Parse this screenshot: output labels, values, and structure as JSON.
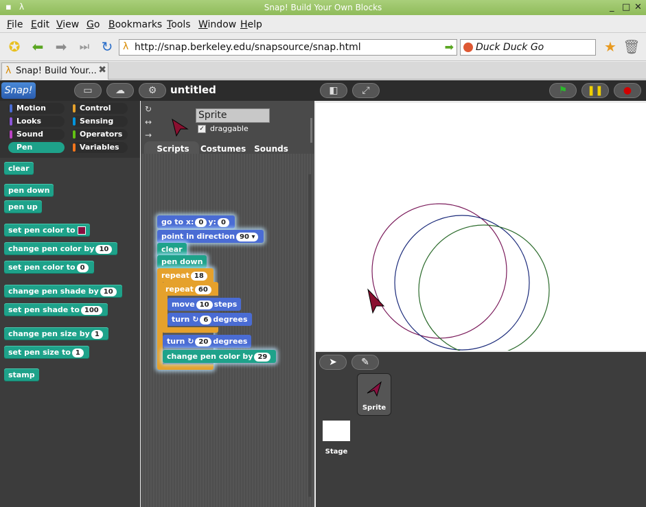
{
  "window": {
    "title": "Snap! Build Your Own Blocks"
  },
  "menu": {
    "items": [
      "File",
      "Edit",
      "View",
      "Go",
      "Bookmarks",
      "Tools",
      "Window",
      "Help"
    ]
  },
  "nav": {
    "url": "http://snap.berkeley.edu/snapsource/snap.html",
    "search_engine": "Duck Duck Go"
  },
  "tabs": [
    {
      "label": "Snap! Build Your..."
    }
  ],
  "snap": {
    "logo": "Snap!",
    "project_name": "untitled",
    "categories": [
      "Motion",
      "Control",
      "Looks",
      "Sensing",
      "Sound",
      "Operators",
      "Pen",
      "Variables"
    ],
    "category_colors": {
      "Motion": "#4a6cd4",
      "Control": "#e5a12c",
      "Looks": "#8a55d7",
      "Sensing": "#0494dc",
      "Sound": "#bb42c3",
      "Operators": "#62c213",
      "Pen": "#1ea28a",
      "Variables": "#f3761d"
    },
    "selected_category": "Pen",
    "palette": [
      {
        "text": "clear"
      },
      {
        "text": "pen down"
      },
      {
        "text": "pen up"
      },
      {
        "text": "set pen color to",
        "color": "#871040"
      },
      {
        "text": "change pen color by",
        "slot": "10"
      },
      {
        "text": "set pen color to",
        "slot": "0"
      },
      {
        "text": "change pen shade by",
        "slot": "10"
      },
      {
        "text": "set pen shade to",
        "slot": "100"
      },
      {
        "text": "change pen size by",
        "slot": "1"
      },
      {
        "text": "set pen size to",
        "slot": "1"
      },
      {
        "text": "stamp"
      }
    ],
    "sprite": {
      "name": "Sprite",
      "draggable_label": "draggable",
      "draggable": true
    },
    "sprite_tabs": [
      "Scripts",
      "Costumes",
      "Sounds"
    ],
    "script": {
      "goto": {
        "label": "go to x:",
        "x": "0",
        "ylabel": "y:",
        "y": "0"
      },
      "point": {
        "label": "point in direction",
        "value": "90"
      },
      "clear": "clear",
      "pendown": "pen down",
      "repeat_outer": {
        "label": "repeat",
        "value": "18"
      },
      "repeat_inner": {
        "label": "repeat",
        "value": "60"
      },
      "move": {
        "label": "move",
        "value": "10",
        "suffix": "steps"
      },
      "turn1": {
        "label": "turn",
        "value": "6",
        "suffix": "degrees"
      },
      "turn2": {
        "label": "turn",
        "value": "20",
        "suffix": "degrees"
      },
      "changecolor": {
        "label": "change pen color by",
        "value": "29"
      }
    },
    "corral": {
      "sprite_label": "Sprite",
      "stage_label": "Stage"
    }
  }
}
